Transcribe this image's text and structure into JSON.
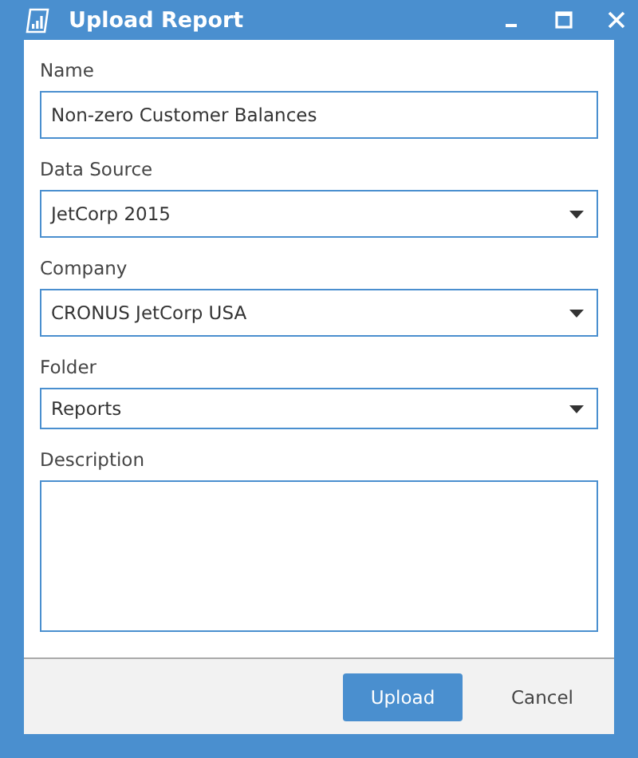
{
  "window": {
    "title": "Upload Report"
  },
  "fields": [
    {
      "label": "Name",
      "kind": "text",
      "value": "Non-zero Customer Balances"
    },
    {
      "label": "Data Source",
      "kind": "select",
      "value": "JetCorp 2015"
    },
    {
      "label": "Company",
      "kind": "select",
      "value": "CRONUS JetCorp USA"
    },
    {
      "label": "Folder",
      "kind": "select",
      "value": "Reports"
    },
    {
      "label": "Description",
      "kind": "textarea"
    }
  ],
  "buttons": [
    {
      "label": "Upload",
      "kind": "primary"
    },
    {
      "label": "Cancel",
      "kind": "plain"
    }
  ]
}
